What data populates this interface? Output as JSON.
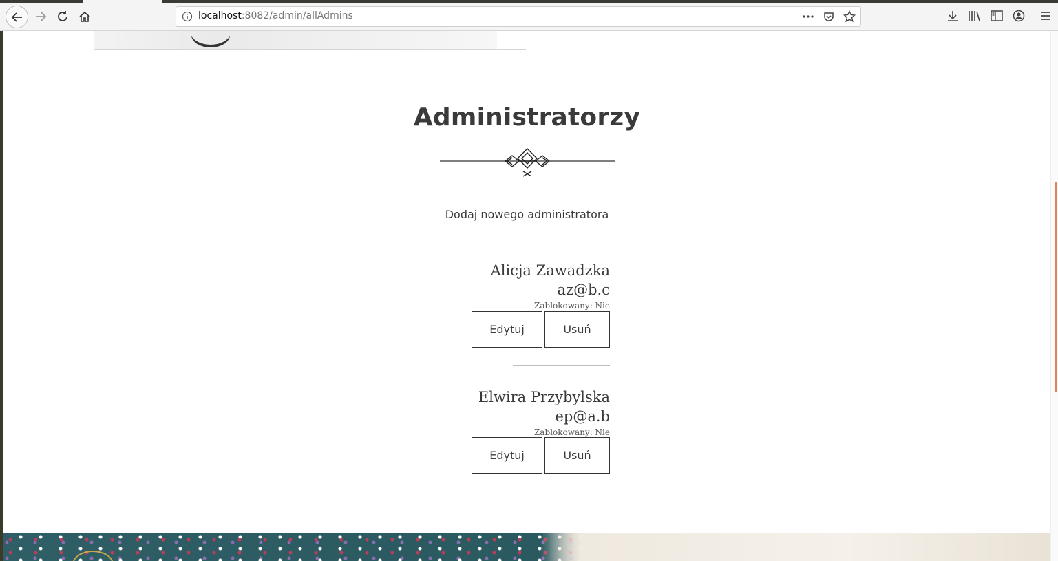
{
  "browser": {
    "url_host": "localhost",
    "url_rest": ":8082/admin/allAdmins"
  },
  "page": {
    "title": "Administratorzy",
    "add_admin_label": "Dodaj nowego administratora",
    "admins": [
      {
        "name": "Alicja Zawadzka",
        "email": "az@b.c",
        "blocked_label": "Zablokowany: Nie",
        "edit_label": "Edytuj",
        "delete_label": "Usuń"
      },
      {
        "name": "Elwira Przybylska",
        "email": "ep@a.b",
        "blocked_label": "Zablokowany: Nie",
        "edit_label": "Edytuj",
        "delete_label": "Usuń"
      }
    ]
  },
  "colors": {
    "scrollbar_accent": "#e0835b",
    "text": "#3a3a3a"
  }
}
